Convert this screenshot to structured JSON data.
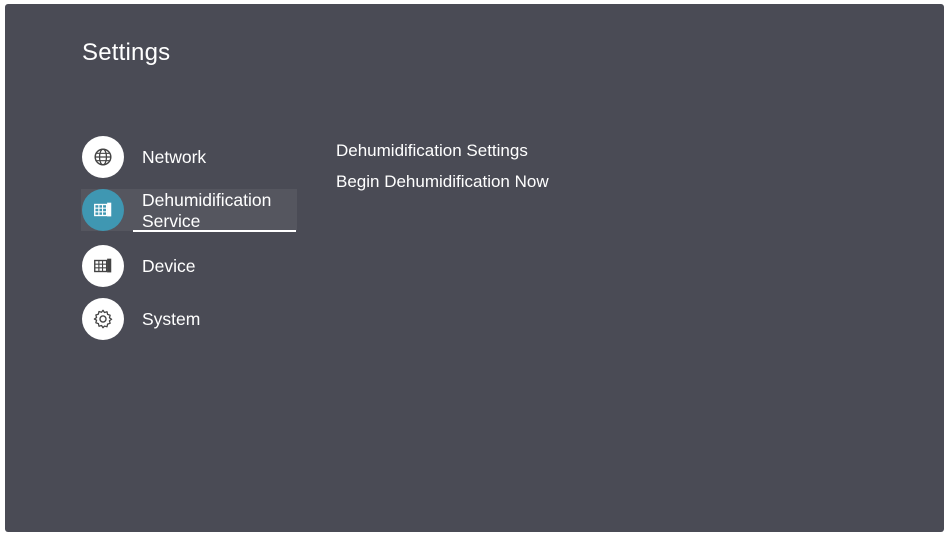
{
  "page": {
    "title": "Settings"
  },
  "menu": {
    "items": [
      {
        "label": "Network",
        "icon": "globe-icon",
        "selected": false
      },
      {
        "label": "Dehumidification Service",
        "icon": "dehumidify-icon",
        "selected": true
      },
      {
        "label": "Device",
        "icon": "device-icon",
        "selected": false
      },
      {
        "label": "System",
        "icon": "gear-icon",
        "selected": false
      }
    ]
  },
  "submenu": {
    "items": [
      {
        "label": "Dehumidification Settings"
      },
      {
        "label": "Begin Dehumidification Now"
      }
    ]
  },
  "colors": {
    "background": "#4a4b55",
    "accent": "#3f97b2",
    "selected_row": "#55565f",
    "text": "#ffffff"
  }
}
